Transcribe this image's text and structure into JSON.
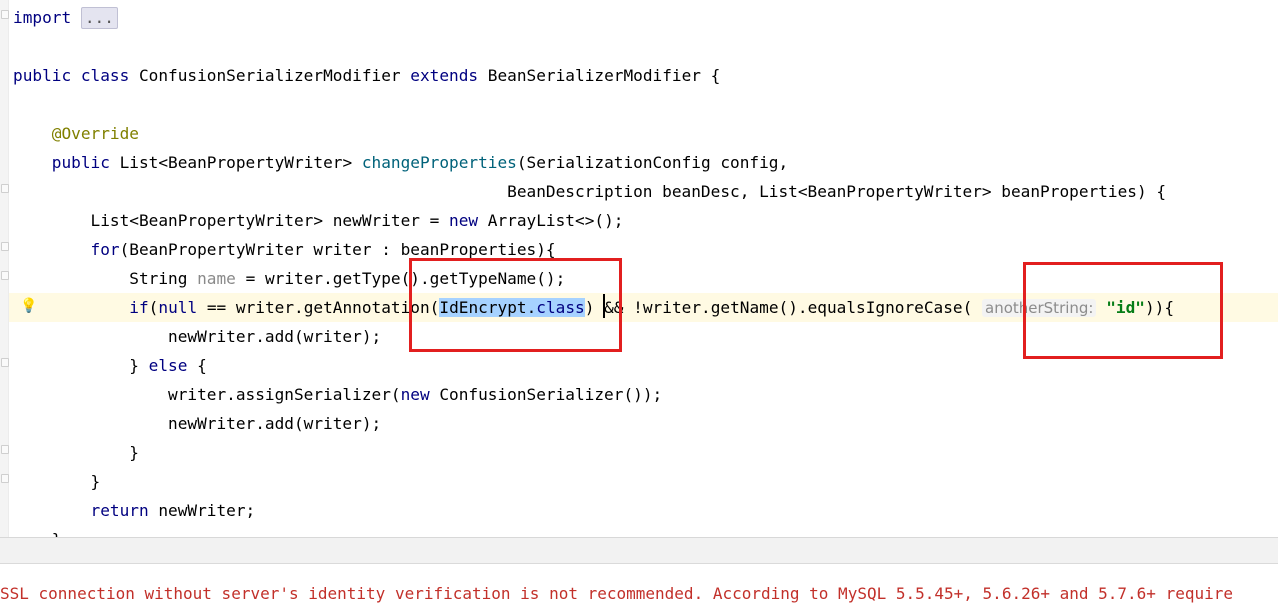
{
  "editor": {
    "lines": [
      [
        {
          "t": "import ",
          "c": "kw"
        },
        {
          "t": "...",
          "c": "fold-ell"
        }
      ],
      [],
      [
        {
          "t": "public class ",
          "c": "kw"
        },
        {
          "t": "ConfusionSerializerModifier "
        },
        {
          "t": "extends ",
          "c": "kw"
        },
        {
          "t": "BeanSerializerModifier {"
        }
      ],
      [],
      [
        {
          "t": "    "
        },
        {
          "t": "@Override",
          "c": "ann"
        }
      ],
      [
        {
          "t": "    "
        },
        {
          "t": "public ",
          "c": "kw"
        },
        {
          "t": "List<BeanPropertyWriter> "
        },
        {
          "t": "changeProperties",
          "c": "method"
        },
        {
          "t": "(SerializationConfig config,"
        }
      ],
      [
        {
          "t": "                                                   BeanDescription beanDesc, List<BeanPropertyWriter> beanProperties) {"
        }
      ],
      [
        {
          "t": "        List<BeanPropertyWriter> newWriter = "
        },
        {
          "t": "new ",
          "c": "kw"
        },
        {
          "t": "ArrayList<>();"
        }
      ],
      [
        {
          "t": "        "
        },
        {
          "t": "for",
          "c": "kw"
        },
        {
          "t": "(BeanPropertyWriter writer : beanProperties){"
        }
      ],
      [
        {
          "t": "            String "
        },
        {
          "t": "name",
          "c": "unused"
        },
        {
          "t": " = writer.getType().getTypeName();"
        }
      ],
      [
        {
          "t": "            "
        },
        {
          "t": "if",
          "c": "kw"
        },
        {
          "t": "("
        },
        {
          "t": "null",
          "c": "kw"
        },
        {
          "t": " == writer.getAnnotation("
        },
        {
          "t": "IdEncrypt.",
          "c": "sel"
        },
        {
          "t": "class",
          "c": "sel kw"
        },
        {
          "t": ") && !writer.getName().equalsIgnoreCase( "
        },
        {
          "t": "anotherString:",
          "c": "hint"
        },
        {
          "t": " "
        },
        {
          "t": "\"id\"",
          "c": "str"
        },
        {
          "t": ")){"
        }
      ],
      [
        {
          "t": "                newWriter.add(writer);"
        }
      ],
      [
        {
          "t": "            } "
        },
        {
          "t": "else",
          "c": "kw"
        },
        {
          "t": " {"
        }
      ],
      [
        {
          "t": "                writer.assignSerializer("
        },
        {
          "t": "new ",
          "c": "kw"
        },
        {
          "t": "ConfusionSerializer());"
        }
      ],
      [
        {
          "t": "                newWriter.add(writer);"
        }
      ],
      [
        {
          "t": "            }"
        }
      ],
      [
        {
          "t": "        }"
        }
      ],
      [
        {
          "t": "        "
        },
        {
          "t": "return ",
          "c": "kw"
        },
        {
          "t": "newWriter;"
        }
      ],
      [
        {
          "t": "    }"
        }
      ]
    ]
  },
  "console": {
    "text": "SSL connection without server's identity verification is not recommended. According to MySQL 5.5.45+, 5.6.26+ and 5.7.6+ require"
  },
  "colors": {
    "keyword": "#000080",
    "annotation": "#808000",
    "method": "#00627a",
    "string": "#067d17",
    "selection": "#a6d2ff",
    "current_line": "#fffae3",
    "annotation_box": "#e21f1f",
    "console_error": "#c2302a"
  },
  "icons": {
    "intention": "lightbulb-icon",
    "fold": "fold-marker-icon"
  }
}
